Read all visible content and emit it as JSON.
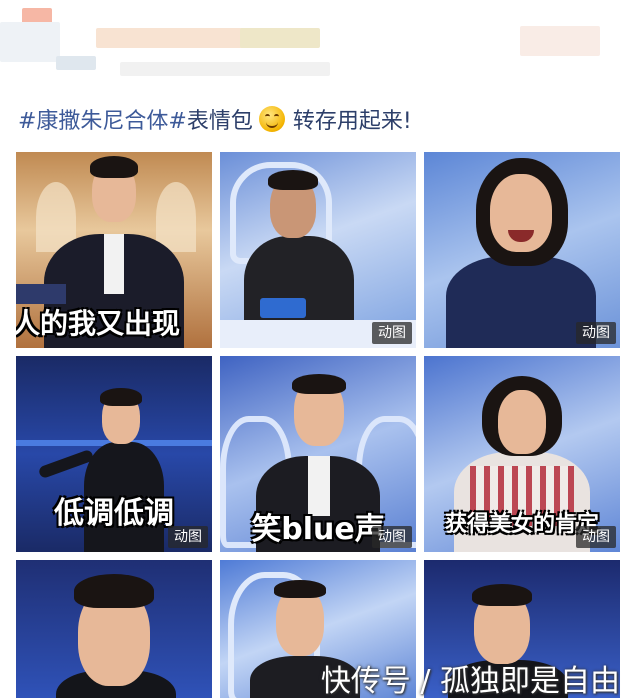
{
  "post": {
    "hashtag1": "#康撒朱尼合体#",
    "text1": "表情包",
    "emoji": "smiling-face-icon",
    "text2": "转存用起来!"
  },
  "tiles": [
    {
      "caption": "人的我又出现",
      "badge": ""
    },
    {
      "caption": "",
      "badge": "动图"
    },
    {
      "caption": "",
      "badge": "动图"
    },
    {
      "caption": "低调低调",
      "badge": "动图"
    },
    {
      "caption": "笑blue声",
      "badge": "动图"
    },
    {
      "caption": "获得美女的肯定",
      "badge": "动图"
    },
    {
      "caption": "",
      "badge": ""
    },
    {
      "caption": "",
      "badge": ""
    },
    {
      "caption": "",
      "badge": ""
    }
  ],
  "watermark": "快传号 / 孤独即是自由"
}
